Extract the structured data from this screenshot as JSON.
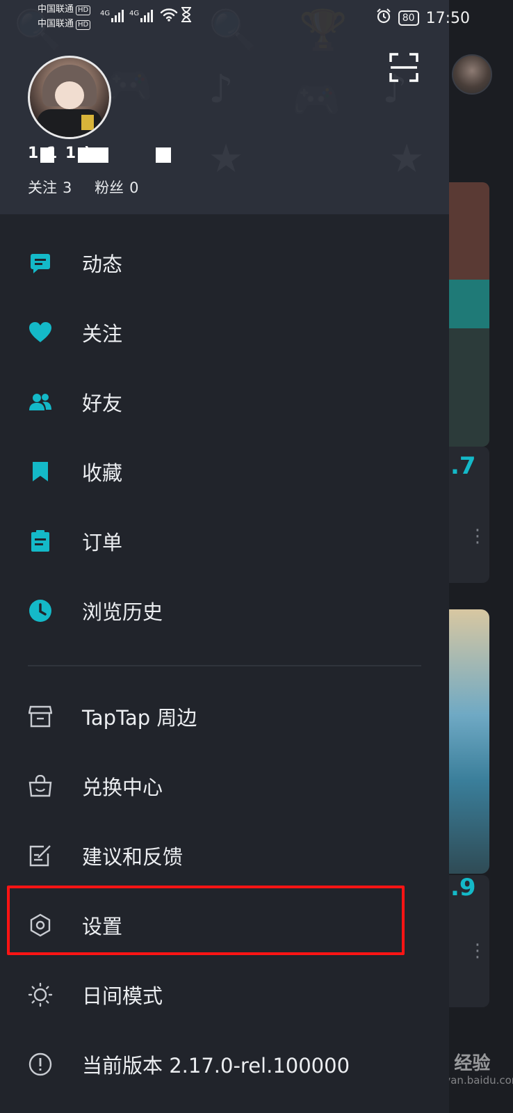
{
  "status_bar": {
    "carrier_1": "中国联通",
    "carrier_2": "中国联通",
    "hd_badge": "HD",
    "network_1": "4G",
    "network_2": "4G",
    "battery": "80",
    "time": "17:50"
  },
  "profile": {
    "username": "1     1        1 )",
    "following_label": "关注",
    "following_count": "3",
    "followers_label": "粉丝",
    "followers_count": "0",
    "scan_icon": "scan-icon"
  },
  "menu": {
    "items": [
      {
        "label": "动态",
        "icon": "message-icon"
      },
      {
        "label": "关注",
        "icon": "heart-icon"
      },
      {
        "label": "好友",
        "icon": "friends-icon"
      },
      {
        "label": "收藏",
        "icon": "bookmark-icon"
      },
      {
        "label": "订单",
        "icon": "order-icon"
      },
      {
        "label": "浏览历史",
        "icon": "clock-icon"
      }
    ],
    "secondary": [
      {
        "label": "TapTap 周边",
        "icon": "store-icon"
      },
      {
        "label": "兑换中心",
        "icon": "bag-icon"
      },
      {
        "label": "建议和反馈",
        "icon": "edit-icon"
      },
      {
        "label": "设置",
        "icon": "hexagon-settings-icon"
      },
      {
        "label": "日间模式",
        "icon": "sun-icon"
      },
      {
        "label": "当前版本 2.17.0-rel.100000",
        "icon": "info-icon"
      }
    ]
  },
  "background_app": {
    "score_1": ".7",
    "score_2": ".9"
  },
  "watermark": {
    "brand": "Bai 经验",
    "url": "jingyan.baidu.com"
  },
  "colors": {
    "accent": "#14b9c8",
    "drawer_bg": "#21242b",
    "header_bg": "#2c303a",
    "highlight": "#ff1414"
  }
}
